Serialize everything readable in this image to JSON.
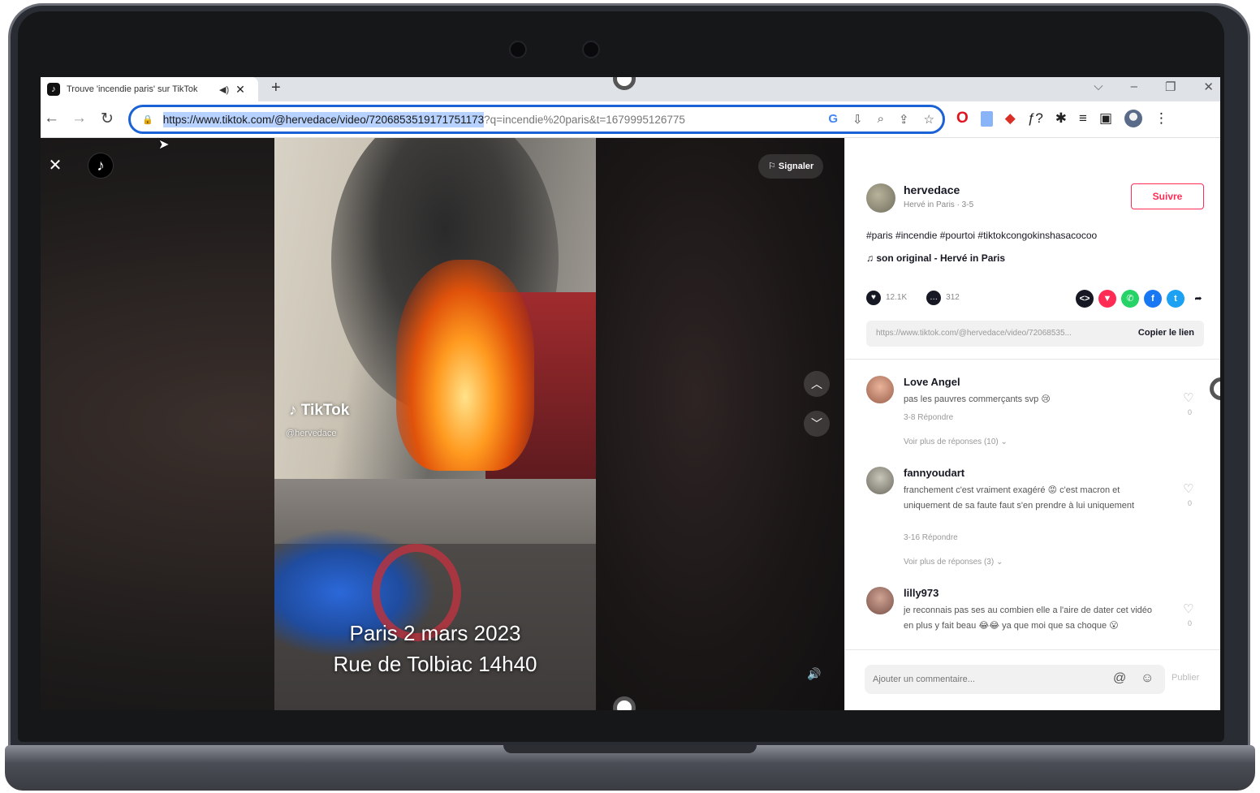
{
  "browser": {
    "tab_title": "Trouve 'incendie paris' sur TikTok",
    "tab_favicon": "tiktok-icon",
    "url_selected": "https://www.tiktok.com/@hervedace/video/7206853519171751173",
    "url_rest": "?q=incendie%20paris&t=1679995126775",
    "new_tab": "+",
    "minimize": "–",
    "restore": "❐",
    "close": "✕",
    "dropdown": "⌵"
  },
  "video": {
    "watermark": "TikTok",
    "watermark_handle": "@hervedace",
    "caption_line1": "Paris 2 mars 2023",
    "caption_line2": "Rue de Tolbiac 14h40",
    "report_label": "Signaler"
  },
  "panel": {
    "author_name": "hervedace",
    "author_sub": "Hervé in Paris · 3-5",
    "follow_label": "Suivre",
    "hashtags": "#paris #incendie #pourtoi #tiktokcongokinshasacocoo",
    "sound": "son original - Hervé in Paris",
    "likes": "12.1K",
    "comments": "312",
    "link_url": "https://www.tiktok.com/@hervedace/video/72068535...",
    "copy_link": "Copier le lien",
    "comment_placeholder": "Ajouter un commentaire...",
    "post_label": "Publier"
  },
  "comments": [
    {
      "name": "Love Angel",
      "text": "pas les pauvres commerçants svp 😢",
      "meta": "3-8      Répondre",
      "more": "Voir plus de réponses (10) ⌄",
      "likes": "0"
    },
    {
      "name": "fannyoudart",
      "text": "franchement c'est vraiment exagéré 😡 c'est macron et uniquement de sa faute faut s'en prendre à lui uniquement",
      "meta": "3-16      Répondre",
      "more": "Voir plus de réponses (3) ⌄",
      "likes": "0"
    },
    {
      "name": "lilly973",
      "text": "je reconnais pas ses au combien elle a l'aire de dater cet vidéo en plus y fait beau 😂😂 ya que moi que sa choque 😮",
      "likes": "0"
    }
  ],
  "colors": {
    "accent": "#fe2c55",
    "omnibox_border": "#1a62d6"
  }
}
